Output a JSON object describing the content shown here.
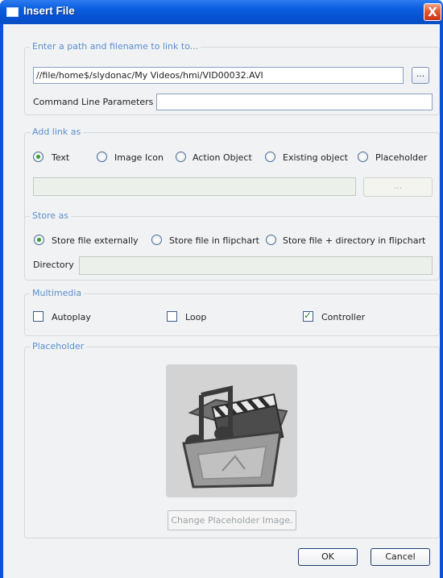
{
  "window": {
    "title": "Insert File",
    "close_glyph": "X"
  },
  "path_group": {
    "legend": "Enter a path and filename to link to...",
    "path_value": "//file/home$/slydonac/My Videos/hmi/VID00032.AVI",
    "browse_label": "...",
    "params_label": "Command Line Parameters",
    "params_value": ""
  },
  "link_group": {
    "legend": "Add link as",
    "options": [
      "Text",
      "Image Icon",
      "Action Object",
      "Existing object",
      "Placeholder"
    ],
    "selected": "Text",
    "field_value": "",
    "browse_label": "..."
  },
  "store_group": {
    "legend": "Store as",
    "options": [
      "Store file externally",
      "Store file in flipchart",
      "Store file + directory in flipchart"
    ],
    "selected": "Store file externally",
    "directory_label": "Directory",
    "directory_value": ""
  },
  "multimedia_group": {
    "legend": "Multimedia",
    "autoplay_label": "Autoplay",
    "autoplay_checked": false,
    "loop_label": "Loop",
    "loop_checked": false,
    "controller_label": "Controller",
    "controller_checked": true
  },
  "placeholder_group": {
    "legend": "Placeholder",
    "image_icon": "media-folder-icon",
    "change_button_label": "Change Placeholder Image."
  },
  "footer": {
    "ok_label": "OK",
    "cancel_label": "Cancel"
  },
  "colors": {
    "title_bar": "#0b5fe0",
    "legend_text": "#5a8fd0",
    "client_bg": "#f1f2f3",
    "close_button": "#e25a32"
  }
}
